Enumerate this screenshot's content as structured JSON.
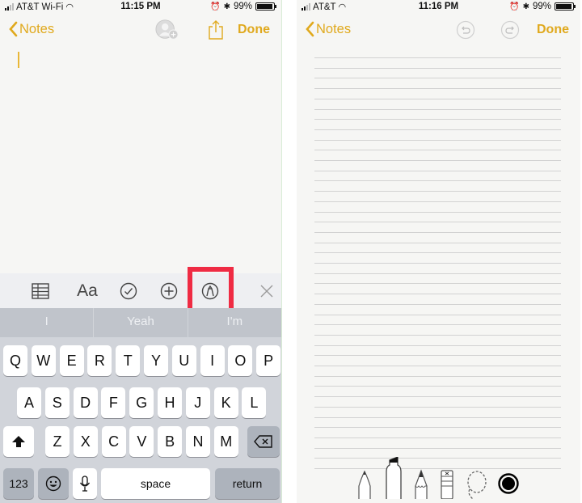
{
  "left_screen": {
    "status_bar": {
      "carrier": "AT&T Wi-Fi",
      "time": "11:15 PM",
      "battery": "99%",
      "battery_level": 0.99
    },
    "nav": {
      "back_label": "Notes",
      "done_label": "Done",
      "icons": [
        "add-person-icon",
        "share-icon"
      ]
    },
    "format_toolbar": {
      "icons": [
        "table-icon",
        "text-format-icon",
        "checklist-icon",
        "insert-icon",
        "markup-icon",
        "close-icon"
      ],
      "text_format_label": "Aa",
      "highlighted": "markup-icon",
      "highlight_color": "#ef2b43"
    },
    "suggestions": [
      "I",
      "Yeah",
      "I'm"
    ],
    "keyboard": {
      "row1": [
        "Q",
        "W",
        "E",
        "R",
        "T",
        "Y",
        "U",
        "I",
        "O",
        "P"
      ],
      "row2": [
        "A",
        "S",
        "D",
        "F",
        "G",
        "H",
        "J",
        "K",
        "L"
      ],
      "row3": [
        "Z",
        "X",
        "C",
        "V",
        "B",
        "N",
        "M"
      ],
      "numbers_label": "123",
      "space_label": "space",
      "return_label": "return"
    }
  },
  "right_screen": {
    "status_bar": {
      "carrier": "AT&T",
      "time": "11:16 PM",
      "battery": "99%",
      "battery_level": 0.99
    },
    "nav": {
      "back_label": "Notes",
      "done_label": "Done",
      "icons": [
        "undo-icon",
        "redo-icon"
      ]
    },
    "drawing_tools": [
      "pen",
      "marker",
      "pencil",
      "eraser",
      "lasso",
      "color-picker"
    ],
    "selected_color": "#000000"
  },
  "colors": {
    "accent": "#e0a91d",
    "highlight": "#ef2b43"
  }
}
